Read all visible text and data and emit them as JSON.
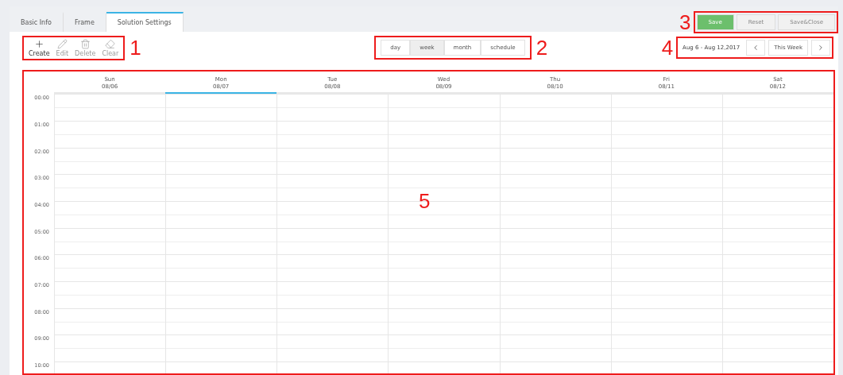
{
  "tabs": [
    {
      "label": "Basic Info",
      "selected": false
    },
    {
      "label": "Frame",
      "selected": false
    },
    {
      "label": "Solution Settings",
      "selected": true
    }
  ],
  "actions": [
    {
      "kind": "create",
      "label": "Create",
      "disabled": false
    },
    {
      "kind": "edit",
      "label": "Edit",
      "disabled": true
    },
    {
      "kind": "delete",
      "label": "Delete",
      "disabled": true
    },
    {
      "kind": "clear",
      "label": "Clear",
      "disabled": true
    }
  ],
  "views": [
    {
      "label": "day",
      "selected": false
    },
    {
      "label": "week",
      "selected": true
    },
    {
      "label": "month",
      "selected": false
    },
    {
      "label": "schedule",
      "selected": false
    }
  ],
  "buttons": [
    {
      "label": "Save",
      "disabled": false
    },
    {
      "label": "Reset",
      "disabled": true
    },
    {
      "label": "Save&Close",
      "disabled": true
    }
  ],
  "date_range": "Aug 6 - Aug 12,2017",
  "this_week": "This Week",
  "days": [
    {
      "name": "Sun",
      "date": "08/06",
      "selected": false
    },
    {
      "name": "Mon",
      "date": "08/07",
      "selected": true
    },
    {
      "name": "Tue",
      "date": "08/08",
      "selected": false
    },
    {
      "name": "Wed",
      "date": "08/09",
      "selected": false
    },
    {
      "name": "Thu",
      "date": "08/10",
      "selected": false
    },
    {
      "name": "Fri",
      "date": "08/11",
      "selected": false
    },
    {
      "name": "Sat",
      "date": "08/12",
      "selected": false
    }
  ],
  "hours": [
    "00:00",
    "01:00",
    "02:00",
    "03:00",
    "04:00",
    "05:00",
    "06:00",
    "07:00",
    "08:00",
    "09:00",
    "10:00"
  ],
  "callouts": [
    "1",
    "2",
    "3",
    "4",
    "5"
  ]
}
